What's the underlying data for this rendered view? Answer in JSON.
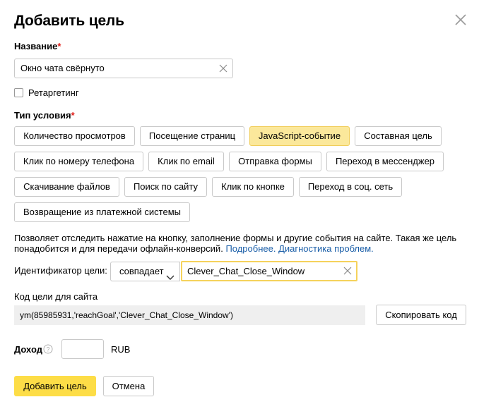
{
  "dialog": {
    "title": "Добавить цель",
    "close_icon": "close-icon"
  },
  "name": {
    "label": "Название",
    "required_mark": "*",
    "value": "Окно чата свёрнуто"
  },
  "retargeting": {
    "label": "Ретаргетинг",
    "checked": false
  },
  "condition": {
    "label": "Тип условия",
    "required_mark": "*",
    "options": [
      "Количество просмотров",
      "Посещение страниц",
      "JavaScript-событие",
      "Составная цель",
      "Клик по номеру телефона",
      "Клик по email",
      "Отправка формы",
      "Переход в мессенджер",
      "Скачивание файлов",
      "Поиск по сайту",
      "Клик по кнопке",
      "Переход в соц. сеть",
      "Возвращение из платежной системы"
    ],
    "selected": "JavaScript-событие"
  },
  "description": {
    "text": "Позволяет отследить нажатие на кнопку, заполнение формы и другие события на сайте. Такая же цель понадобится и для передачи офлайн-конверсий.",
    "link_more": "Подробнее.",
    "link_diag": "Диагностика проблем."
  },
  "identifier": {
    "label": "Идентификатор цели:",
    "match_mode": "совпадает",
    "value": "Clever_Chat_Close_Window"
  },
  "code": {
    "label": "Код цели для сайта",
    "value": "ym(85985931,'reachGoal','Clever_Chat_Close_Window')",
    "copy_label": "Скопировать код"
  },
  "income": {
    "label": "Доход",
    "value": "",
    "currency": "RUB"
  },
  "actions": {
    "submit_label": "Добавить цель",
    "cancel_label": "Отмена"
  },
  "colors": {
    "accent_yellow": "#fddd47",
    "selected_chip": "#fbe89b",
    "link_blue": "#1a5ea8",
    "required_red": "#e0201b"
  }
}
